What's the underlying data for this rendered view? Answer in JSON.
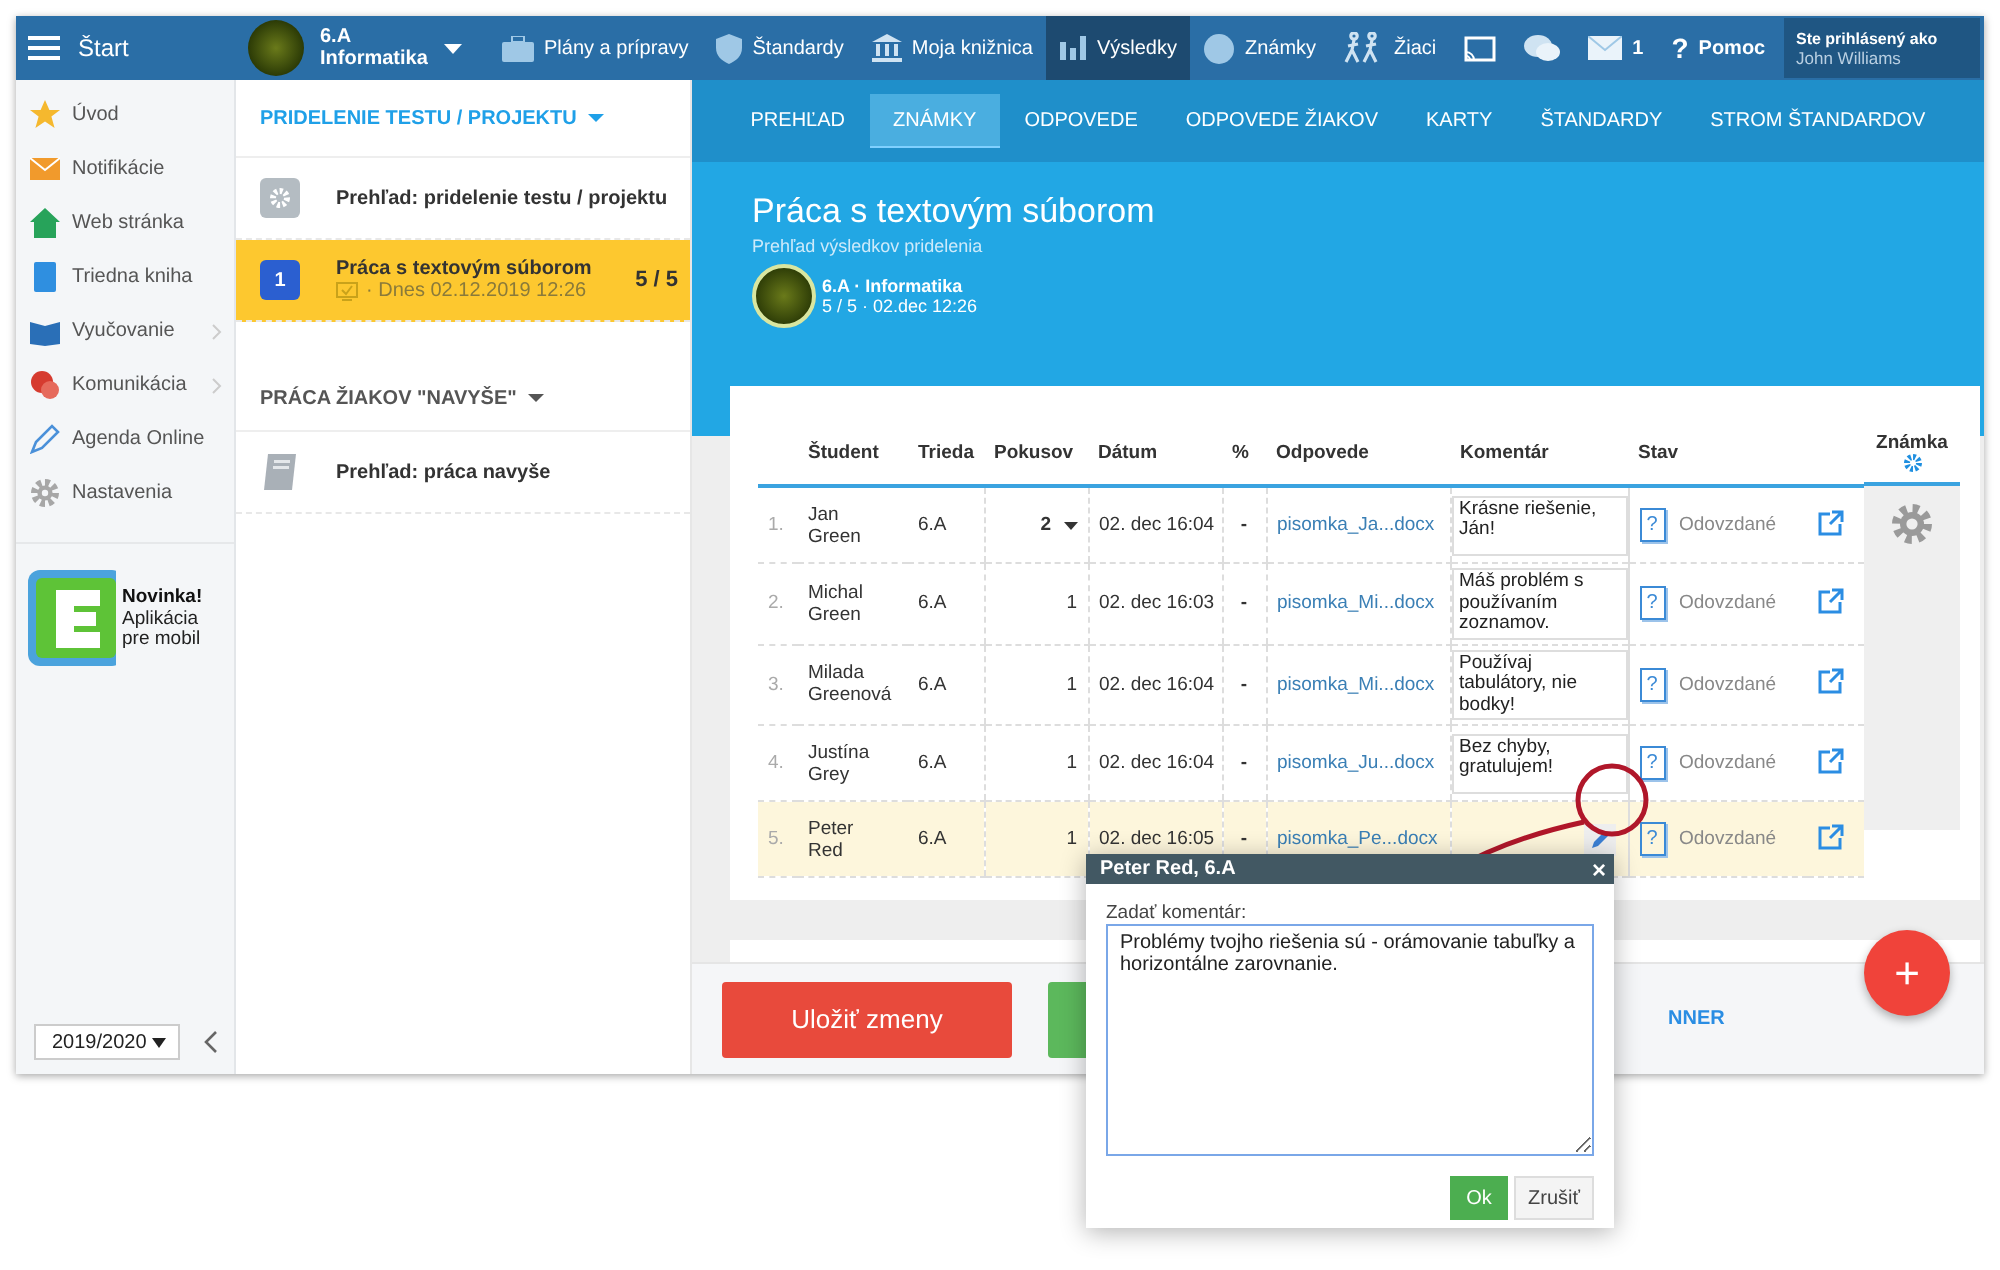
{
  "topbar": {
    "menu": {
      "label": "Štart"
    },
    "class": {
      "name": "6.A",
      "subject": "Informatika"
    },
    "nav": [
      {
        "kind": "plans",
        "label": "Plány a prípravy",
        "selected": false
      },
      {
        "kind": "standards",
        "label": "Štandardy",
        "selected": false
      },
      {
        "kind": "library",
        "label": "Moja knižnica",
        "selected": false
      },
      {
        "kind": "results",
        "label": "Výsledky",
        "selected": true
      },
      {
        "kind": "grades",
        "label": "Známky",
        "selected": false
      },
      {
        "kind": "students",
        "label": "Žiaci",
        "selected": false
      },
      {
        "kind": "cast",
        "selected": false
      },
      {
        "kind": "chat",
        "selected": false
      },
      {
        "kind": "mail",
        "badge": "1",
        "selected": false
      },
      {
        "kind": "help",
        "symbol": "?",
        "label": "Pomoc",
        "selected": false
      }
    ],
    "user": {
      "caption": "Ste prihlásený ako",
      "name": "John Williams"
    }
  },
  "sidebar": {
    "items": [
      {
        "kind": "star",
        "label": "Úvod",
        "submenu": false
      },
      {
        "kind": "mail",
        "label": "Notifikácie",
        "submenu": false
      },
      {
        "kind": "home",
        "label": "Web stránka",
        "submenu": false
      },
      {
        "kind": "classbook",
        "label": "Triedna kniha",
        "submenu": false
      },
      {
        "kind": "teaching",
        "label": "Vyučovanie",
        "submenu": true
      },
      {
        "kind": "chat",
        "label": "Komunikácia",
        "submenu": true
      },
      {
        "kind": "pen",
        "label": "Agenda Online",
        "submenu": false
      },
      {
        "kind": "gear",
        "label": "Nastavenia",
        "submenu": false
      }
    ],
    "promo": {
      "title": "Novinka!",
      "text": "Aplikácia pre mobil"
    },
    "year": "2019/2020"
  },
  "assignments": {
    "sections": [
      {
        "title": "PRIDELENIE TESTU / PROJEKTU",
        "active": true,
        "items": [
          {
            "kind": "overview",
            "title": "Prehľad: pridelenie testu / projektu",
            "selected": false
          },
          {
            "kind": "numbered",
            "badge": "1",
            "title": "Práca s textovým súborom",
            "date": "· Dnes 02.12.2019 12:26",
            "count": "5 / 5",
            "selected": true
          }
        ]
      },
      {
        "title": "PRÁCA ŽIAKOV \"NAVYŠE\"",
        "active": false,
        "items": [
          {
            "kind": "extra",
            "title": "Prehľad: práca navyše",
            "selected": false
          }
        ]
      }
    ]
  },
  "tabs": [
    {
      "label": "PREHĽAD",
      "selected": false
    },
    {
      "label": "ZNÁMKY",
      "selected": true
    },
    {
      "label": "ODPOVEDE",
      "selected": false
    },
    {
      "label": "ODPOVEDE ŽIAKOV",
      "selected": false
    },
    {
      "label": "KARTY",
      "selected": false
    },
    {
      "label": "ŠTANDARDY",
      "selected": false
    },
    {
      "label": "STROM ŠTANDARDOV",
      "selected": false
    }
  ],
  "header": {
    "title": "Práca s textovým súborom",
    "subtitle": "Prehľad výsledkov pridelenia",
    "class": "6.A · Informatika",
    "meta": "5 / 5 · 02.dec 12:26"
  },
  "table": {
    "columns": [
      "Študent",
      "Trieda",
      "Pokusov",
      "Dátum",
      "%",
      "Odpovede",
      "Komentár",
      "Stav",
      "Známka"
    ],
    "rows": [
      {
        "index": "1.",
        "student": "Jan Green",
        "class": "6.A",
        "attempts": "2",
        "attempts_menu": true,
        "date": "02. dec 16:04",
        "percent": "-",
        "file": "pisomka_Ja...docx",
        "comment": "Krásne riešenie, Ján!",
        "status_icon": "?",
        "status": "Odovzdané",
        "selected": false
      },
      {
        "index": "2.",
        "student": "Michal Green",
        "class": "6.A",
        "attempts": "1",
        "attempts_menu": false,
        "date": "02. dec 16:03",
        "percent": "-",
        "file": "pisomka_Mi...docx",
        "comment": "Máš problém s používaním zoznamov.",
        "status_icon": "?",
        "status": "Odovzdané",
        "selected": false
      },
      {
        "index": "3.",
        "student": "Milada Greenová",
        "class": "6.A",
        "attempts": "1",
        "attempts_menu": false,
        "date": "02. dec 16:04",
        "percent": "-",
        "file": "pisomka_Mi...docx",
        "comment": "Používaj tabulátory, nie bodky!",
        "status_icon": "?",
        "status": "Odovzdané",
        "selected": false
      },
      {
        "index": "4.",
        "student": "Justína Grey",
        "class": "6.A",
        "attempts": "1",
        "attempts_menu": false,
        "date": "02. dec 16:04",
        "percent": "-",
        "file": "pisomka_Ju...docx",
        "comment": "Bez chyby, gratulujem!",
        "status_icon": "?",
        "status": "Odovzdané",
        "selected": false
      },
      {
        "index": "5.",
        "student": "Peter Red",
        "class": "6.A",
        "attempts": "1",
        "attempts_menu": false,
        "date": "02. dec 16:05",
        "percent": "-",
        "file": "pisomka_Pe...docx",
        "status_icon": "?",
        "status": "Odovzdané",
        "selected": true
      }
    ]
  },
  "footer": {
    "save": "Uložiť zmeny",
    "link": "NNER",
    "fab": "+"
  },
  "dialog": {
    "title": "Peter Red, 6.A",
    "close": "×",
    "label": "Zadať komentár:",
    "value": "Problémy tvojho riešenia sú - orámovanie tabuľky a horizontálne zarovnanie.",
    "ok": "Ok",
    "cancel": "Zrušiť"
  }
}
